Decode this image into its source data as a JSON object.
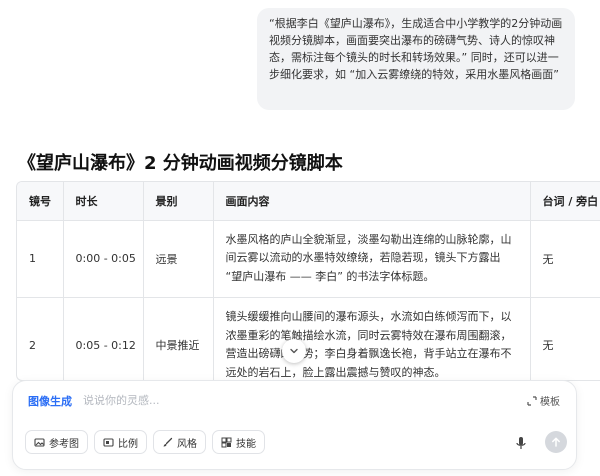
{
  "user_message": {
    "text": "“根据李白《望庐山瀑布》，生成适合中小学教学的2分钟动画视频分镜脚本，画面要突出瀑布的磅礴气势、诗人的惊叹神态，需标注每个镜头的时长和转场效果。” 同时，还可以进一步细化要求，如 “加入云雾缭绕的特效，采用水墨风格画面”"
  },
  "document": {
    "title": "《望庐山瀑布》2 分钟动画视频分镜脚本"
  },
  "table": {
    "headers": [
      "镜号",
      "时长",
      "景别",
      "画面内容",
      "台词 / 旁白"
    ],
    "rows": [
      {
        "shot": "1",
        "duration": "0:00 - 0:05",
        "framing": "远景",
        "content": "水墨风格的庐山全貌渐显，淡墨勾勒出连绵的山脉轮廓，山间云雾以流动的水墨特效缭绕，若隐若现，镜头下方露出 “望庐山瀑布 —— 李白” 的书法字体标题。",
        "dialogue": "无"
      },
      {
        "shot": "2",
        "duration": "0:05 - 0:12",
        "framing": "中景推近",
        "content": "镜头缓缓推向山腰间的瀑布源头，水流如白练倾泻而下，以浓墨重彩的笔触描绘水流，同时云雾特效在瀑布周围翻滚，营造出磅礴的气势；李白身着飘逸长袍，背手站立在瀑布不远处的岩石上，脸上露出震撼与赞叹的神态。",
        "dialogue": "无"
      }
    ]
  },
  "composer": {
    "mode_label": "图像生成",
    "placeholder": "说说你的灵感...",
    "template_label": "模板",
    "chips": [
      {
        "icon": "image-icon",
        "label": "参考图"
      },
      {
        "icon": "ratio-icon",
        "label": "比例"
      },
      {
        "icon": "brush-icon",
        "label": "风格"
      },
      {
        "icon": "skills-icon",
        "label": "技能"
      }
    ]
  }
}
